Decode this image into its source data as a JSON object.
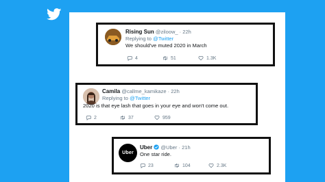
{
  "colors": {
    "background": "#1da1f2",
    "panel": "#ffffff",
    "border": "#111111",
    "link": "#1da1f2",
    "muted": "#657786"
  },
  "brand_icon": "twitter-bird-icon",
  "tweets": [
    {
      "name": "Rising Sun",
      "handle": "@ziloow_",
      "sep": "·",
      "time": "22h",
      "reply_prefix": "Replying to ",
      "reply_to": "@Twitter",
      "text": "We should've muted 2020 in March",
      "replies": "4",
      "retweets": "51",
      "likes": "1.3K"
    },
    {
      "name": "Camila",
      "handle": "@callme_kamikaze",
      "sep": "·",
      "time": "22h",
      "reply_prefix": "Replying to ",
      "reply_to": "@Twitter",
      "text": "2020 is that eye lash that goes in your eye and won't come out.",
      "replies": "2",
      "retweets": "37",
      "likes": "959"
    },
    {
      "name": "Uber",
      "handle": "@Uber",
      "sep": "·",
      "time": "21h",
      "avatar_text": "Uber",
      "text": "One star ride.",
      "replies": "23",
      "retweets": "104",
      "likes": "2.3K"
    }
  ]
}
